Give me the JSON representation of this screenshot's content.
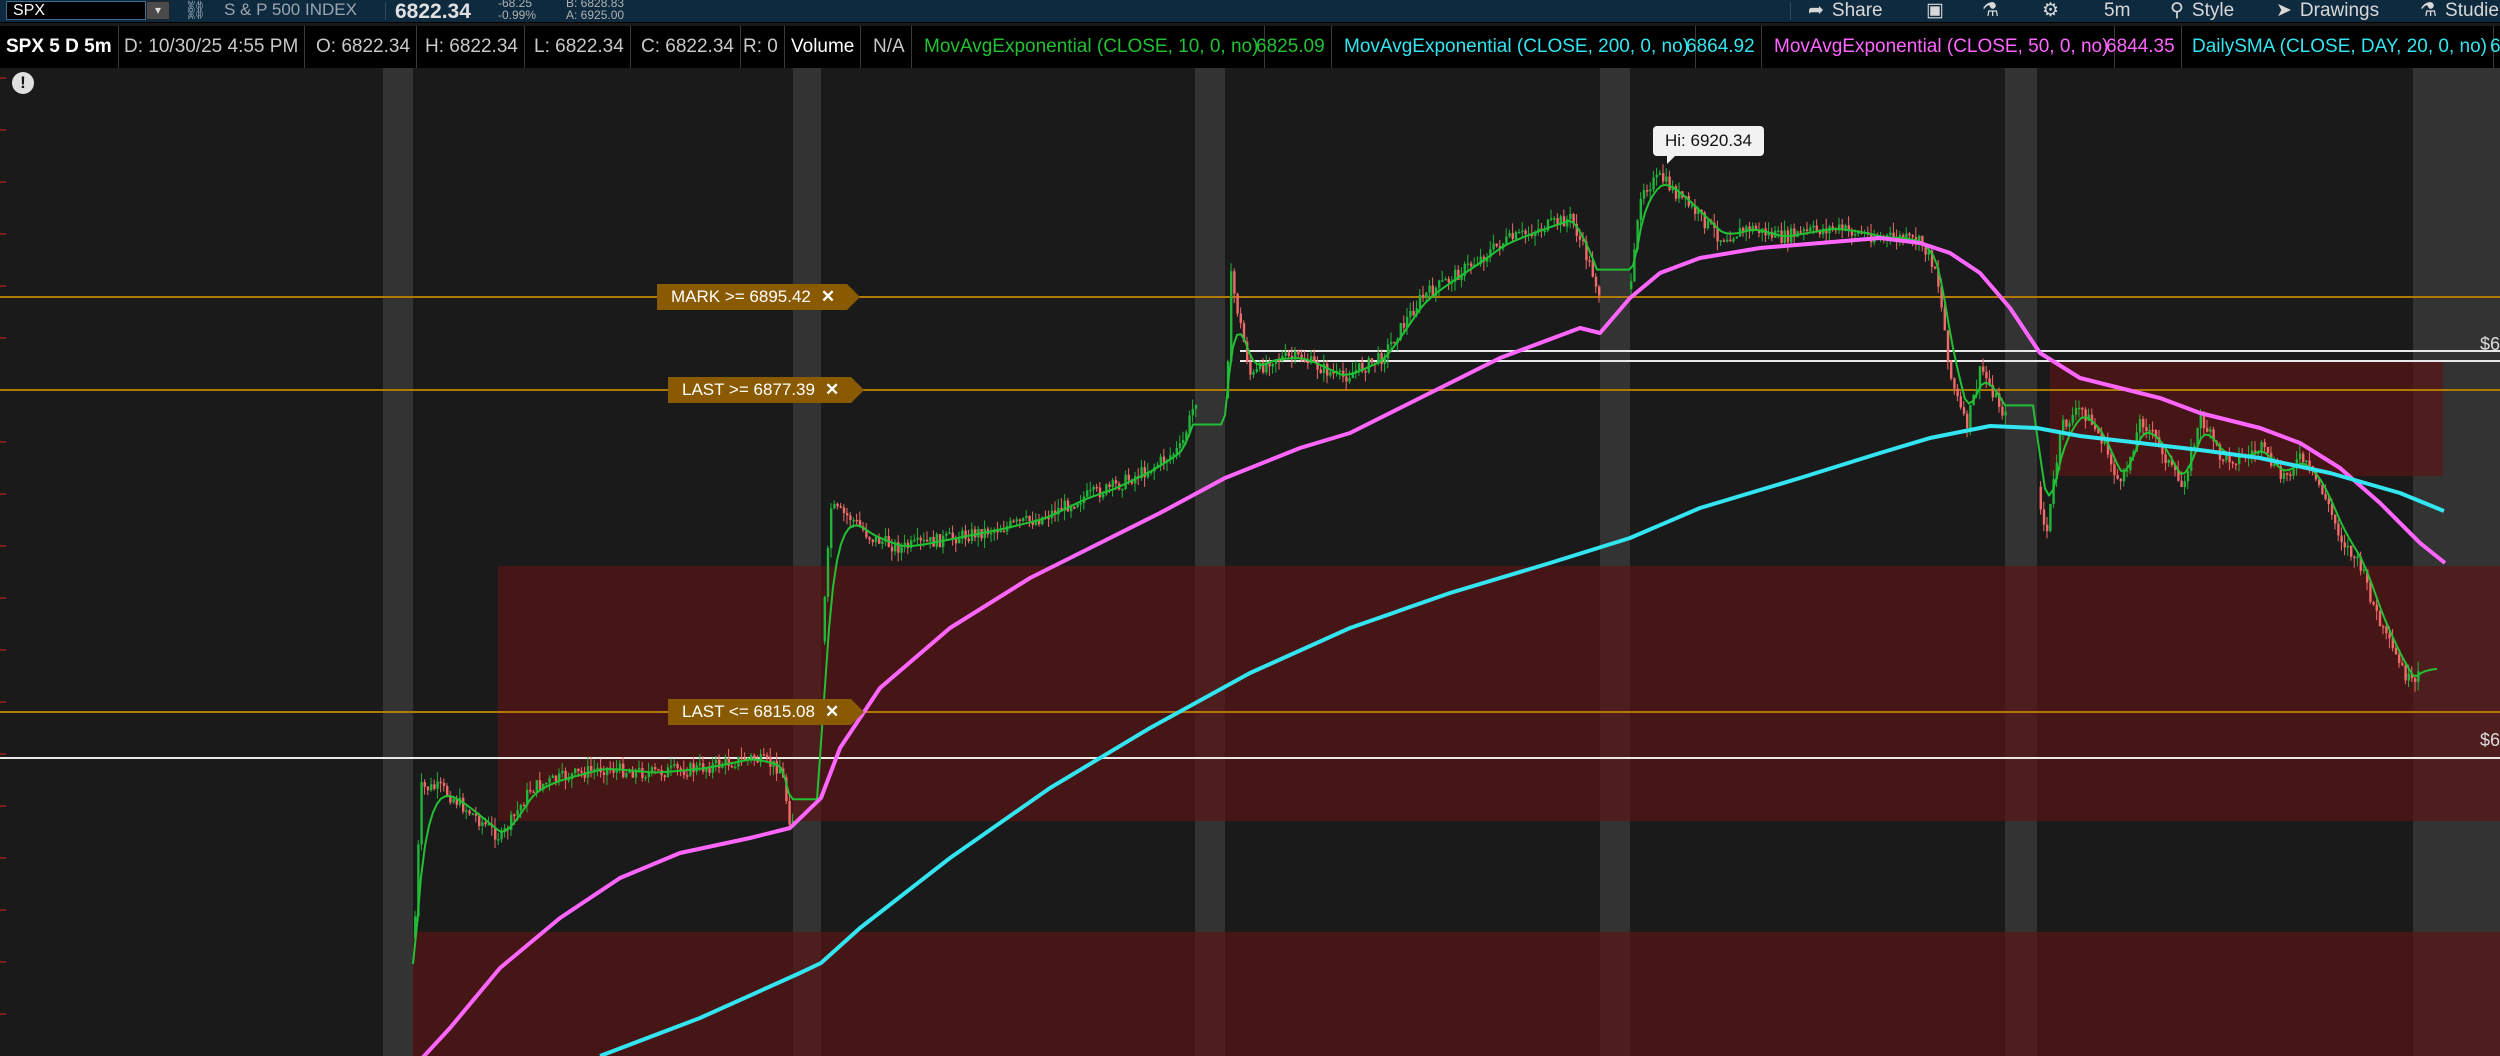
{
  "toolbar": {
    "symbol": "SPX",
    "dropdown_glyph": "▾",
    "description": "S & P 500 INDEX",
    "last": "6822.34",
    "change": "-68.25",
    "change_pct": "-0.99%",
    "bid": "B: 6828.83",
    "ask": "A: 6925.00",
    "share_label": "Share",
    "timeframe": "5m",
    "style_label": "Style",
    "drawings_label": "Drawings",
    "studies_label": "Studie"
  },
  "studybar": {
    "title": "SPX 5 D 5m",
    "date": "D: 10/30/25 4:55 PM",
    "open": "O: 6822.34",
    "high": "H: 6822.34",
    "low": "L: 6822.34",
    "close": "C: 6822.34",
    "range": "R: 0",
    "volume_label": "Volume",
    "volume_value": "N/A",
    "ema10_label": "MovAvgExponential (CLOSE, 10, 0, no)",
    "ema10_value": "6825.09",
    "ema200_label": "MovAvgExponential (CLOSE, 200, 0, no)",
    "ema200_value": "6864.92",
    "ema50_label": "MovAvgExponential (CLOSE, 50, 0, no)",
    "ema50_value": "6844.35",
    "dsma_label": "DailySMA (CLOSE, DAY, 20, 0, no)",
    "dsma_value": "6"
  },
  "chart": {
    "alert_glyph": "!",
    "hi_label": "Hi: 6920.34",
    "orders": [
      {
        "text": "MARK >= 6895.42",
        "close": "✕"
      },
      {
        "text": "LAST >= 6877.39",
        "close": "✕"
      },
      {
        "text": "LAST <= 6815.08",
        "close": "✕"
      }
    ],
    "right_tag_1": "$6",
    "right_tag_2": "$6"
  },
  "colors": {
    "ema10": "#22c033",
    "ema50": "#ff66ff",
    "ema200": "#33e5f0",
    "up_candle": "#1fb53a",
    "down_candle": "#f06a6a",
    "alert_line": "#b07a00",
    "toolbar_bg": "#0d2a3f"
  }
}
